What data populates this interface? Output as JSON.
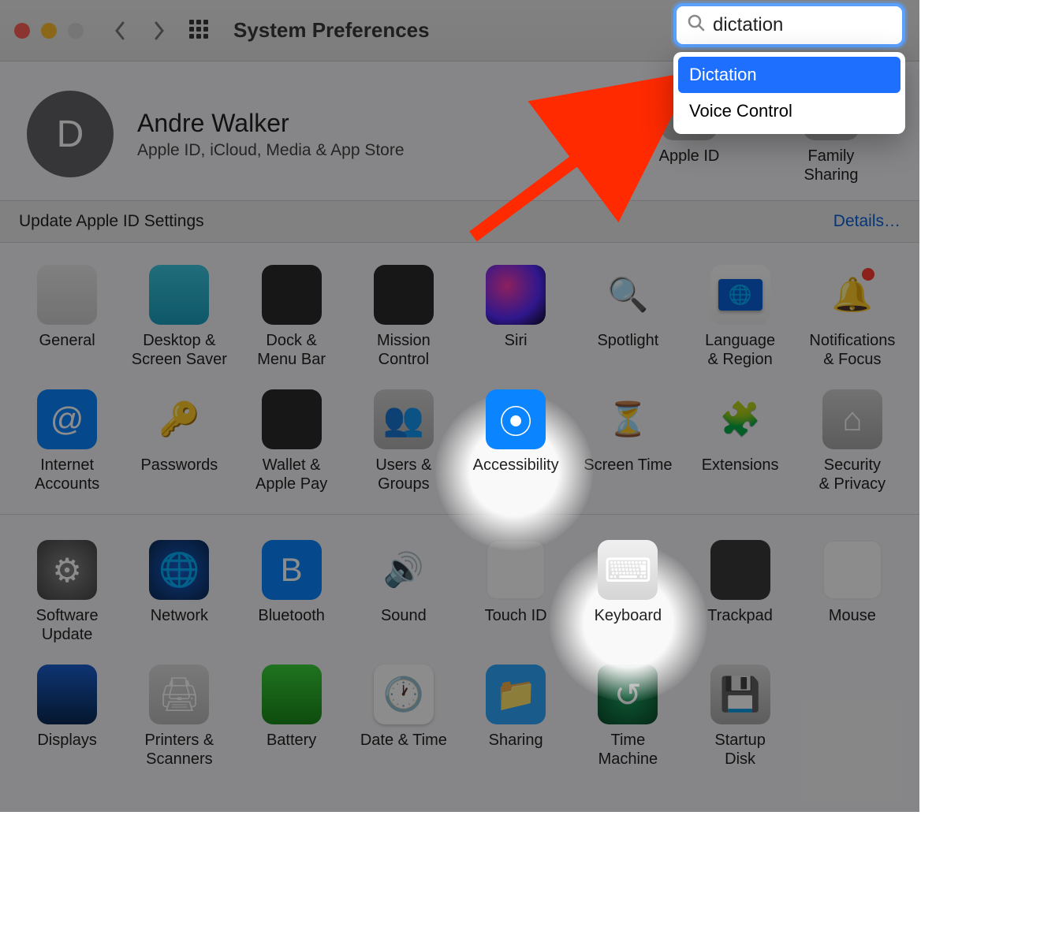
{
  "window": {
    "title": "System Preferences"
  },
  "search": {
    "value": "dictation",
    "results": [
      "Dictation",
      "Voice Control"
    ],
    "selected_index": 0
  },
  "profile": {
    "initial": "D",
    "name": "Andre Walker",
    "subtitle": "Apple ID, iCloud, Media & App Store"
  },
  "header_panes": [
    {
      "id": "apple-id",
      "label": "Apple ID"
    },
    {
      "id": "family-sharing",
      "label": "Family\nSharing"
    }
  ],
  "strip": {
    "text": "Update Apple ID Settings",
    "link": "Details…"
  },
  "rows": [
    [
      {
        "id": "general",
        "label": "General"
      },
      {
        "id": "desktop",
        "label": "Desktop &\nScreen Saver"
      },
      {
        "id": "dock",
        "label": "Dock &\nMenu Bar"
      },
      {
        "id": "mission",
        "label": "Mission\nControl"
      },
      {
        "id": "siri",
        "label": "Siri"
      },
      {
        "id": "spotlight",
        "label": "Spotlight"
      },
      {
        "id": "language",
        "label": "Language\n& Region"
      },
      {
        "id": "notifications",
        "label": "Notifications\n& Focus"
      }
    ],
    [
      {
        "id": "internet",
        "label": "Internet\nAccounts"
      },
      {
        "id": "passwords",
        "label": "Passwords"
      },
      {
        "id": "wallet",
        "label": "Wallet &\nApple Pay"
      },
      {
        "id": "users",
        "label": "Users &\nGroups"
      },
      {
        "id": "accessibility",
        "label": "Accessibility"
      },
      {
        "id": "screentime",
        "label": "Screen Time"
      },
      {
        "id": "extensions",
        "label": "Extensions"
      },
      {
        "id": "security",
        "label": "Security\n& Privacy"
      }
    ],
    [
      {
        "id": "software",
        "label": "Software\nUpdate"
      },
      {
        "id": "network",
        "label": "Network"
      },
      {
        "id": "bluetooth",
        "label": "Bluetooth"
      },
      {
        "id": "sound",
        "label": "Sound"
      },
      {
        "id": "touchid",
        "label": "Touch ID"
      },
      {
        "id": "keyboard",
        "label": "Keyboard"
      },
      {
        "id": "trackpad",
        "label": "Trackpad"
      },
      {
        "id": "mouse",
        "label": "Mouse"
      }
    ],
    [
      {
        "id": "displays",
        "label": "Displays"
      },
      {
        "id": "printers",
        "label": "Printers &\nScanners"
      },
      {
        "id": "battery",
        "label": "Battery"
      },
      {
        "id": "datetime",
        "label": "Date & Time"
      },
      {
        "id": "sharing",
        "label": "Sharing"
      },
      {
        "id": "timemachine",
        "label": "Time\nMachine"
      },
      {
        "id": "startup",
        "label": "Startup\nDisk"
      }
    ]
  ],
  "highlighted_panes": [
    "accessibility",
    "keyboard"
  ]
}
